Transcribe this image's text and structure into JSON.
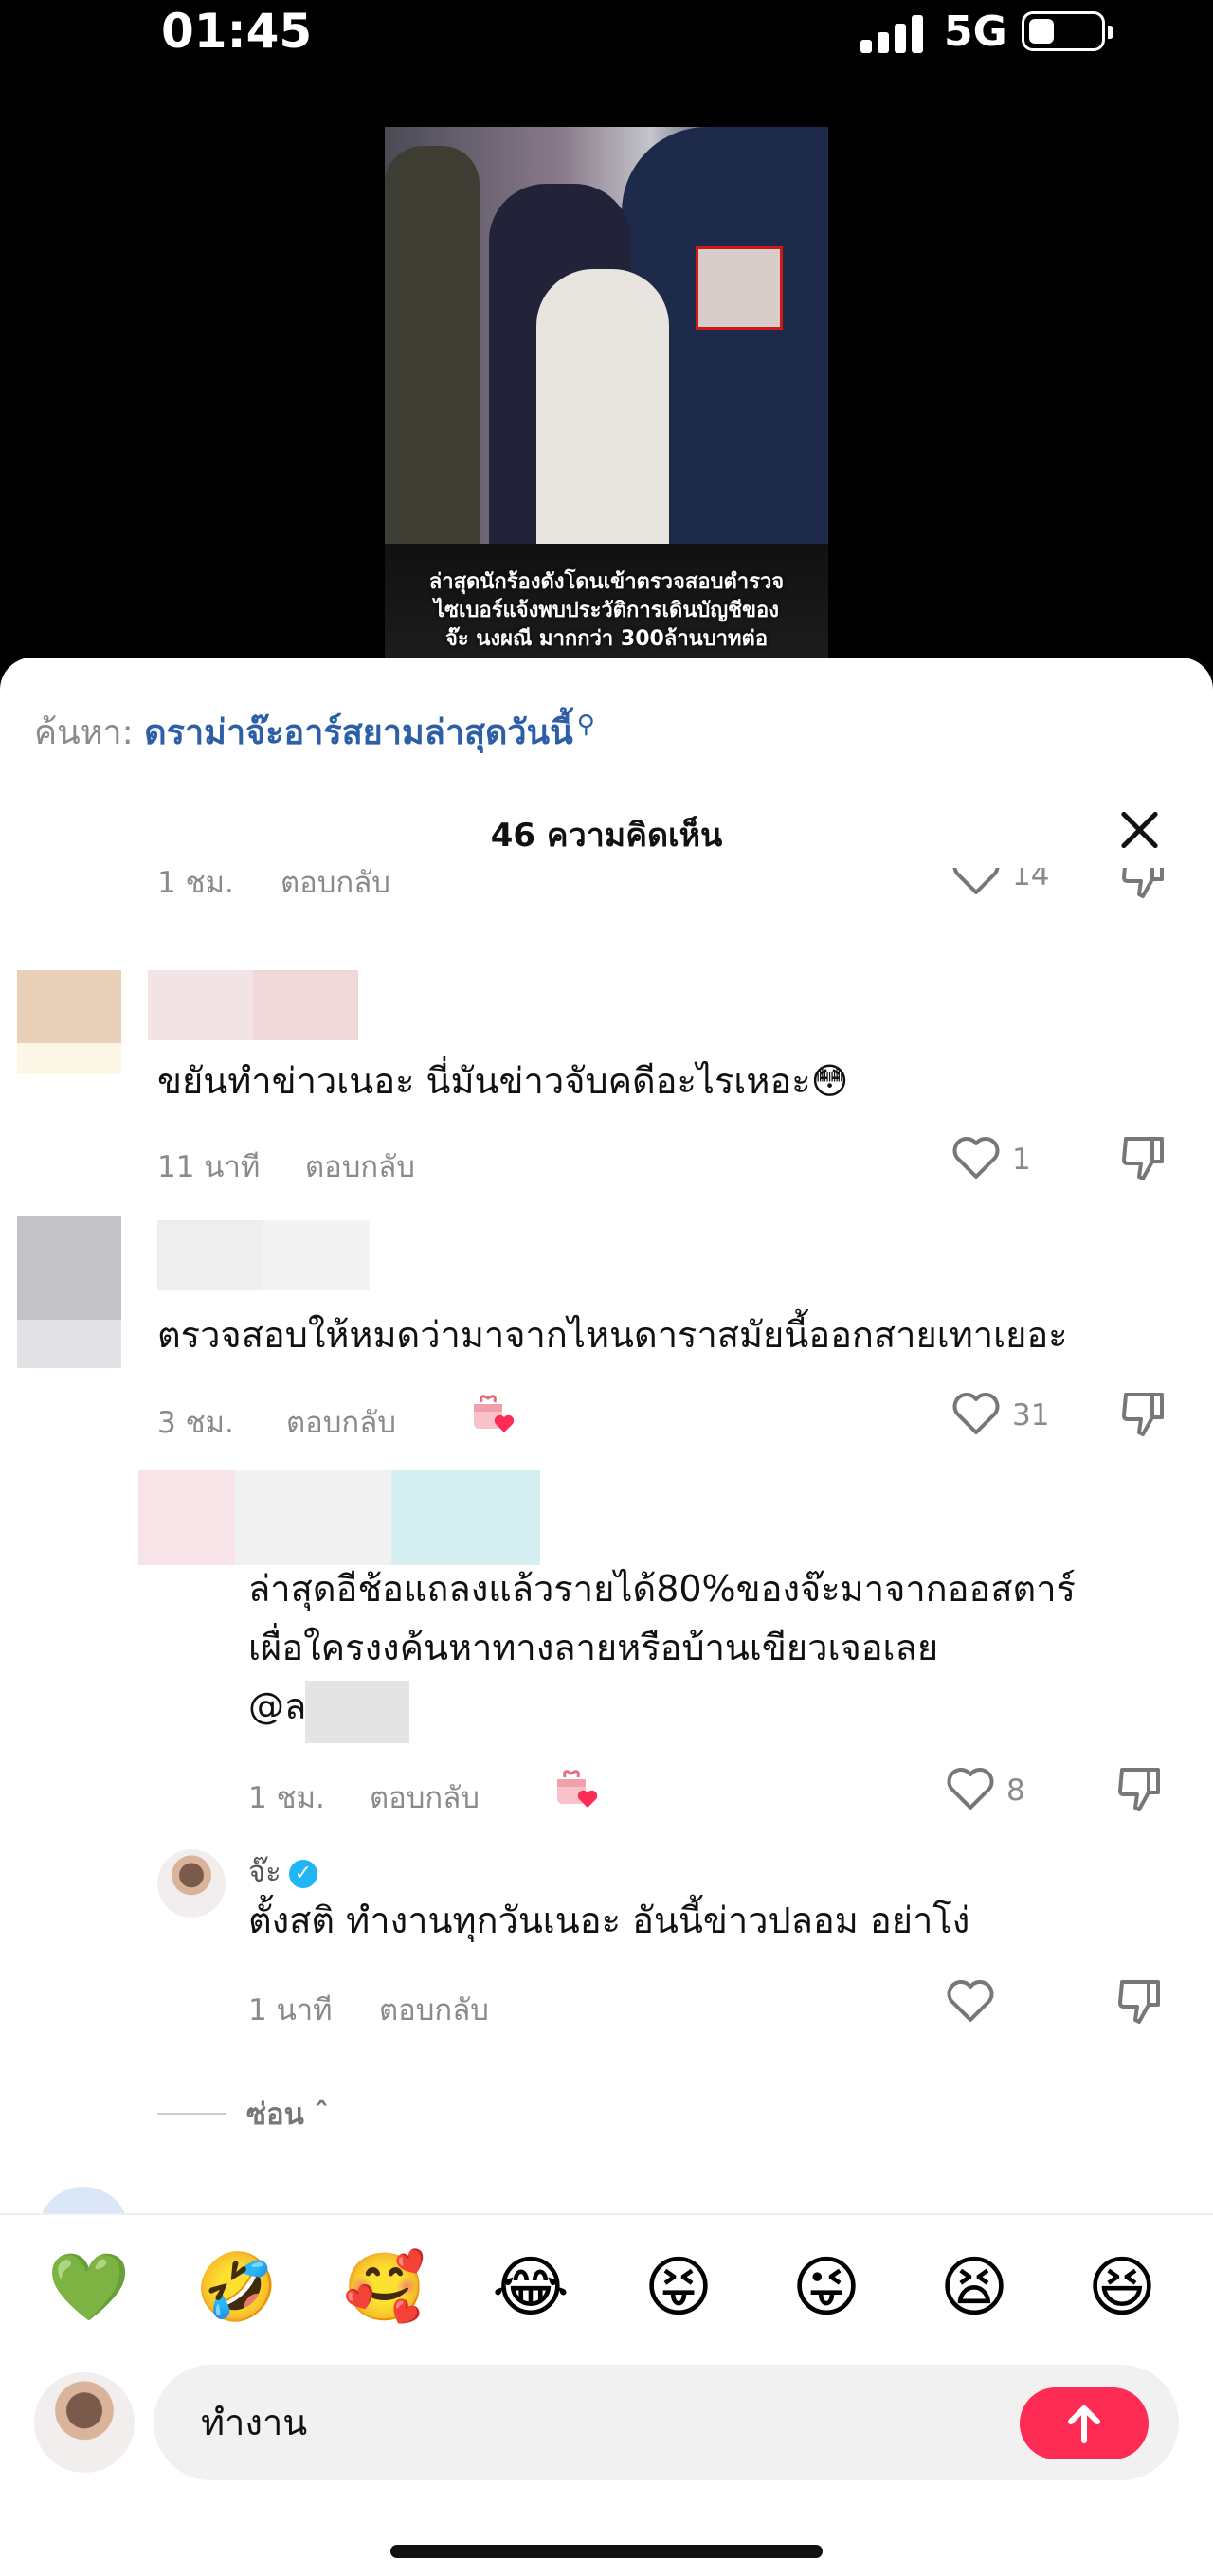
{
  "status_bar": {
    "time": "01:45",
    "network": "5G"
  },
  "video": {
    "caption_lines": [
      "ล่าสุดนักร้องดังโดนเข้าตรวจสอบตำรวจ",
      "ไซเบอร์แจ้งพบประวัติการเดินบัญชีของ",
      "จ๊ะ นงผณี มากกว่า 300ล้านบาทต่อ"
    ]
  },
  "search": {
    "prefix": "ค้นหา:",
    "term": "ดราม่าจ๊ะอาร์สยามล่าสุดวันนี้",
    "icon": "search-icon"
  },
  "header": {
    "title": "46 ความคิดเห็น"
  },
  "comments": [
    {
      "time": "1 ชม.",
      "reply": "ตอบกลับ",
      "likes": "14"
    },
    {
      "text": "ขยันทำข่าวเนอะ นี่มันข่าวจับคดีอะไรเหอะ😳",
      "time": "11 นาที",
      "reply": "ตอบกลับ",
      "likes": "1"
    },
    {
      "text": "ตรวจสอบให้หมดว่ามาจากไหนดาราสมัยนี้ออกสายเทาเยอะ",
      "time": "3 ชม.",
      "reply": "ตอบกลับ",
      "likes": "31"
    },
    {
      "text_lines": [
        "ล่าสุดอีช้อแถลงแล้วรายได้80%ของจ๊ะมาจากออสตาร์",
        "เผื่อใครงงค้นหาทางลายหรือบ้านเขียวเจอเลย",
        "@ล"
      ],
      "time": "1 ชม.",
      "reply": "ตอบกลับ",
      "likes": "8"
    },
    {
      "author": "จ๊ะ",
      "text": "ตั้งสติ ทำงานทุกวันเนอะ อันนี้ข่าวปลอม อย่าโง่",
      "time": "1 นาที",
      "reply": "ตอบกลับ",
      "likes": ""
    }
  ],
  "hide_replies": "ซ่อน",
  "emojis": [
    "💚",
    "🤣",
    "🥰",
    "😂",
    "😝",
    "😜",
    "😫",
    "😆"
  ],
  "input": {
    "text": "ทำงาน"
  },
  "colors": {
    "accent": "#fe2c55",
    "link": "#2c5fa8",
    "verified": "#20b5f5"
  }
}
